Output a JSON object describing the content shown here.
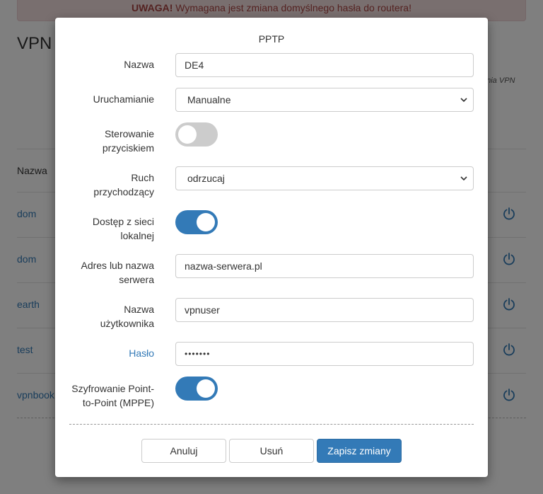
{
  "background": {
    "alert": {
      "prefix": "UWAGA!",
      "text": " Wymagana jest zmiana domyślnego hasła do routera!"
    },
    "page_title": "VPN",
    "note": "enia VPN",
    "column_header": "Nazwa",
    "rows": [
      {
        "name": "dom",
        "icon": "power-icon"
      },
      {
        "name": "dom",
        "icon": "power-icon"
      },
      {
        "name": "earth",
        "icon": "power-icon"
      },
      {
        "name": "test",
        "icon": "power-icon"
      },
      {
        "name": "vpnbook",
        "icon": "power-icon"
      }
    ]
  },
  "modal": {
    "title": "PPTP",
    "fields": {
      "name": {
        "label": "Nazwa",
        "value": "DE4"
      },
      "startup": {
        "label": "Uruchamianie",
        "value": "Manualne"
      },
      "button_control": {
        "label_line1": "Sterowanie",
        "label_line2": "przyciskiem",
        "on": false
      },
      "incoming": {
        "label_line1": "Ruch",
        "label_line2": "przychodzący",
        "value": "odrzucaj"
      },
      "lan_access": {
        "label_line1": "Dostęp z sieci",
        "label_line2": "lokalnej",
        "on": true
      },
      "server": {
        "label_line1": "Adres lub nazwa",
        "label_line2": "serwera",
        "value": "nazwa-serwera.pl"
      },
      "username": {
        "label_line1": "Nazwa",
        "label_line2": "użytkownika",
        "value": "vpnuser"
      },
      "password": {
        "label": "Hasło",
        "value": "•••••••"
      },
      "mppe": {
        "label_line1": "Szyfrowanie Point-",
        "label_line2": "to-Point (MPPE)",
        "on": true
      }
    },
    "buttons": {
      "cancel": "Anuluj",
      "delete": "Usuń",
      "save": "Zapisz zmiany"
    }
  },
  "colors": {
    "primary": "#337ab7",
    "toggle_off": "#cccccc",
    "alert_bg": "#f2dede",
    "alert_text": "#a94442"
  }
}
